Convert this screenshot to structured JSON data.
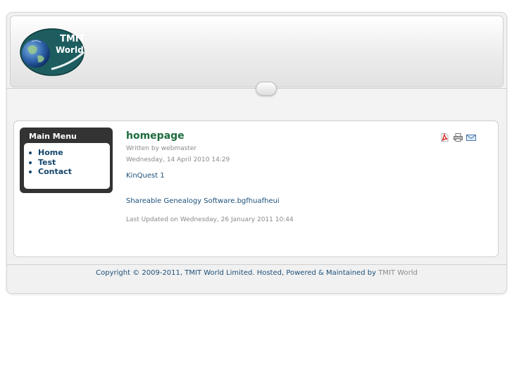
{
  "logo": {
    "line1": "TMIT",
    "line2": "World"
  },
  "menu": {
    "title": "Main Menu",
    "items": [
      {
        "label": "Home"
      },
      {
        "label": "Test"
      },
      {
        "label": "Contact"
      }
    ]
  },
  "article": {
    "title": "homepage",
    "author": "Written by webmaster",
    "date": "Wednesday, 14 April 2010 14:29",
    "paragraphs": [
      "KinQuest 1",
      "Shareable Genealogy Software.bgfhuafheui"
    ],
    "updated": "Last Updated on Wednesday, 26 January 2011 10:44"
  },
  "icons": [
    "pdf-icon",
    "print-icon",
    "email-icon"
  ],
  "footer": {
    "text": "Copyright © 2009-2011, TMIT World Limited. Hosted, Powered & Maintained by",
    "brand": "TMIT World"
  },
  "colors": {
    "menu_background": "#333333",
    "title_green": "#1c6b3e",
    "link_blue": "#1b4f79",
    "meta_gray": "#8a8a8a"
  }
}
